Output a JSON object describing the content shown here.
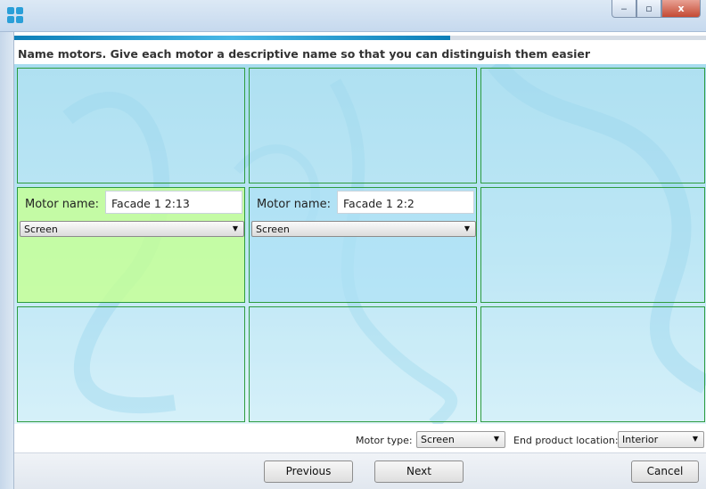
{
  "window": {
    "minimize_glyph": "‒",
    "maximize_glyph": "▫",
    "close_glyph": "x"
  },
  "wizard": {
    "progress_fraction": 0.63,
    "instruction": "Name motors. Give each motor a descriptive name so that you can distinguish them easier"
  },
  "motors": [
    {
      "label": "Motor name:",
      "name": "Facade 1 2:13",
      "type": "Screen"
    },
    {
      "label": "Motor name:",
      "name": "Facade 1 2:2",
      "type": "Screen"
    }
  ],
  "options": {
    "motor_type_label": "Motor type:",
    "motor_type_value": "Screen",
    "location_label": "End product location:",
    "location_value": "Interior"
  },
  "footer": {
    "previous_label": "Previous",
    "next_label": "Next",
    "cancel_label": "Cancel"
  },
  "colors": {
    "selected_cell": "#c6ff96",
    "cell_border": "#2d9c3f",
    "progress": "#1b8ec6"
  }
}
